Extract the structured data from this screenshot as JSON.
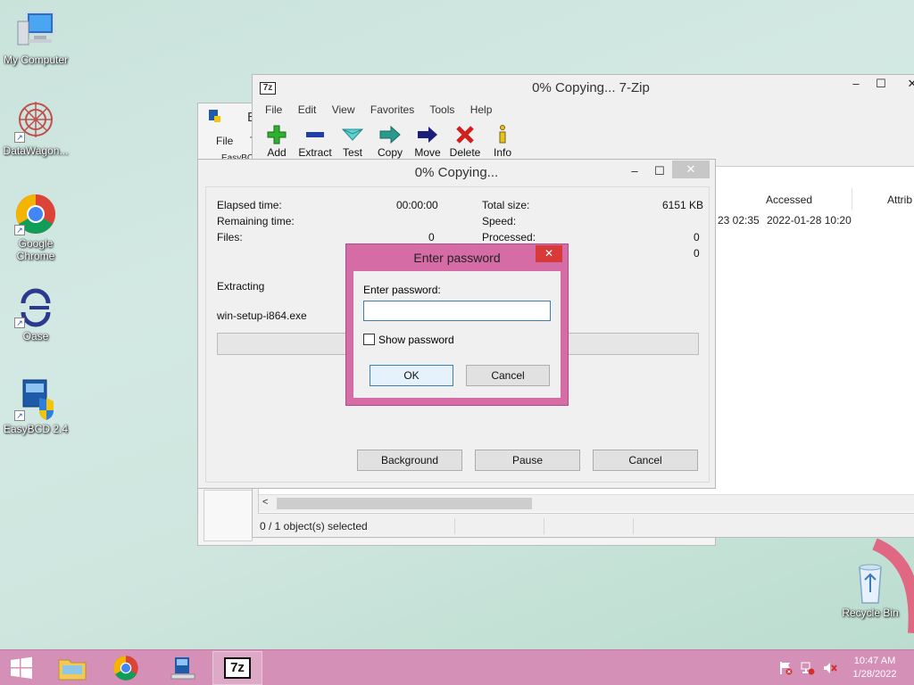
{
  "desktop": {
    "icons": [
      {
        "label": "My Computer"
      },
      {
        "label": "DataWagon..."
      },
      {
        "label": "Google Chrome"
      },
      {
        "label": "Oase"
      },
      {
        "label": "EasyBCD 2.4"
      },
      {
        "label": "Recycle Bin"
      }
    ]
  },
  "back_window": {
    "title_fragment": "E",
    "menu_file": "File",
    "menu_extra": "T",
    "subtitle_fragment": "EasyBC"
  },
  "zip_window": {
    "title": "0% Copying... 7-Zip",
    "menu": [
      "File",
      "Edit",
      "View",
      "Favorites",
      "Tools",
      "Help"
    ],
    "toolbar": [
      {
        "label": "Add",
        "icon": "plus-icon"
      },
      {
        "label": "Extract",
        "icon": "minus-icon"
      },
      {
        "label": "Test",
        "icon": "test-icon"
      },
      {
        "label": "Copy",
        "icon": "copy-arrow-icon"
      },
      {
        "label": "Move",
        "icon": "move-arrow-icon"
      },
      {
        "label": "Delete",
        "icon": "delete-x-icon"
      },
      {
        "label": "Info",
        "icon": "info-icon"
      }
    ],
    "columns": {
      "accessed": "Accessed",
      "attributes": "Attrib"
    },
    "row": {
      "modified_fragment": "23 02:35",
      "accessed": "2022-01-28 10:20"
    },
    "status": "0 / 1 object(s) selected",
    "scroll_left": "<"
  },
  "progress_dialog": {
    "title": "0% Copying...",
    "elapsed_label": "Elapsed time:",
    "elapsed_value": "00:00:00",
    "remaining_label": "Remaining time:",
    "files_label": "Files:",
    "files_value": "0",
    "total_size_label": "Total size:",
    "total_size_value": "6151 KB",
    "speed_label": "Speed:",
    "processed_label": "Processed:",
    "processed_value": "0",
    "extra_value": "0",
    "operation": "Extracting",
    "filename": "win-setup-i864.exe",
    "progress_fraction": 0,
    "buttons": {
      "background": "Background",
      "pause": "Pause",
      "cancel": "Cancel"
    }
  },
  "password_dialog": {
    "title": "Enter password",
    "prompt": "Enter password:",
    "input_value": "",
    "show_password_label": "Show password",
    "show_password_checked": false,
    "ok": "OK",
    "cancel": "Cancel"
  },
  "taskbar": {
    "time": "10:47 AM",
    "date": "1/28/2022",
    "accent": "#d590b8"
  }
}
